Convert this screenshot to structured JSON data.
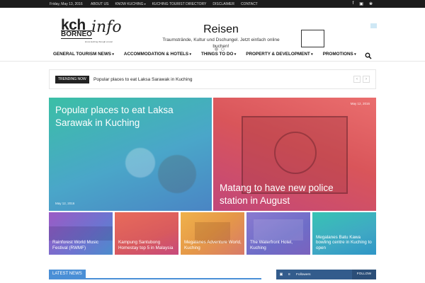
{
  "topbar": {
    "date": "Friday, May 13, 2016",
    "links": [
      "About us",
      "Know Kuching",
      "Kuching Tourist Directory",
      "Disclaimer",
      "Contact"
    ],
    "social": [
      "facebook-icon",
      "instagram-icon",
      "twitter-icon"
    ]
  },
  "logo": {
    "line1": "kch",
    "line2": "BORNEO",
    "script": "info",
    "tagline": "know kuching through a local"
  },
  "ad": {
    "title": "Reisen",
    "description": "Traumstrände, Kultur und Dschungel. Jetzt einfach online buchen!"
  },
  "nav": {
    "items": [
      "General Tourism News",
      "Accommodation & Hotels",
      "Things to do",
      "Property & Development",
      "Promotions"
    ]
  },
  "trending": {
    "badge": "TRENDING NOW",
    "headline": "Popular places to eat Laksa Sarawak in Kuching"
  },
  "featured": [
    {
      "title": "Popular places to eat Laksa Sarawak in Kuching",
      "date": "May 12, 2016"
    },
    {
      "title": "Matang to have new police station in August",
      "date": "May 12, 2016"
    }
  ],
  "small_tiles": [
    {
      "title": "Rainforest World Music Festival (RWMF)"
    },
    {
      "title": "Kampung Santubong Homestay top 5 in Malaysia"
    },
    {
      "title": "Megalanes Adventure World, Kuching"
    },
    {
      "title": "The Waterfront Hotel, Kuching"
    },
    {
      "title": "Megalanes Batu Kawa bowling centre in Kuching to open"
    }
  ],
  "latest": {
    "label": "LATEST NEWS"
  },
  "follow": {
    "count": "8",
    "label": "Followers",
    "button": "FOLLOW"
  },
  "colors": {
    "accent": "#4a8fd6",
    "topbar": "#1c1c1c",
    "follow": "#335c8c"
  }
}
